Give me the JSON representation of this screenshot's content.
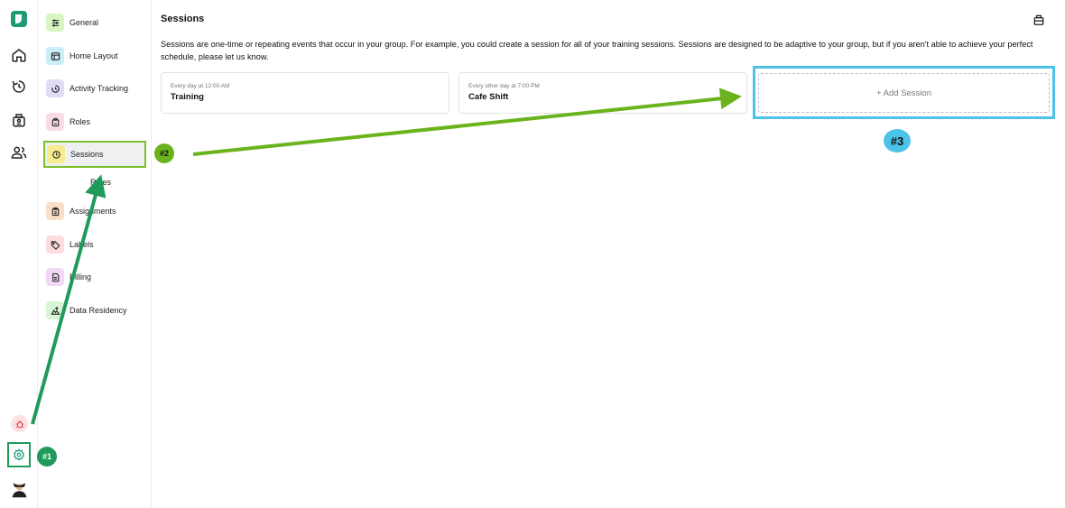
{
  "rail": {
    "items": [
      {
        "icon": "home-icon"
      },
      {
        "icon": "activity-icon"
      },
      {
        "icon": "roles-icon"
      },
      {
        "icon": "members-icon"
      }
    ],
    "bottom": {
      "bug_icon": "bug-icon",
      "settings_icon": "gear-icon",
      "avatar": "avatar"
    }
  },
  "nav": {
    "items": [
      {
        "label": "General",
        "icon": "sliders-icon",
        "color": "#d9f5c4"
      },
      {
        "label": "Home Layout",
        "icon": "layout-icon",
        "color": "#c9eef7"
      },
      {
        "label": "Activity Tracking",
        "icon": "timer-icon",
        "color": "#e3dcf7"
      },
      {
        "label": "Roles",
        "icon": "badge-icon",
        "color": "#f9dbe8"
      },
      {
        "label": "Sessions",
        "icon": "clock-icon",
        "color": "#f9eb8f"
      },
      {
        "label": "Assignments",
        "icon": "clipboard-icon",
        "color": "#fadfc7"
      },
      {
        "label": "Labels",
        "icon": "tag-icon",
        "color": "#fcdcdc"
      },
      {
        "label": "Billing",
        "icon": "file-icon",
        "color": "#f2d7f7"
      },
      {
        "label": "Data Residency",
        "icon": "location-icon",
        "color": "#d9f5d5"
      }
    ],
    "sub_label": "Roles"
  },
  "main": {
    "title": "Sessions",
    "description": "Sessions are one-time or repeating events that occur in your group. For example, you could create a session for all of your training sessions. Sessions are designed to be adaptive to your group, but if you aren't able to achieve your perfect schedule, please let us know.",
    "sessions": [
      {
        "schedule": "Every day at 12:00 AM",
        "name": "Training"
      },
      {
        "schedule": "Every other day at 7:00 PM",
        "name": "Cafe Shift"
      }
    ],
    "add_label": "+ Add Session"
  },
  "annotations": {
    "step1": "#1",
    "step2": "#2",
    "step3": "#3"
  },
  "colors": {
    "accent": "#1f9a76",
    "step1": "#1f9a5a",
    "step2": "#6bb31d",
    "step3": "#4ec3e8"
  }
}
